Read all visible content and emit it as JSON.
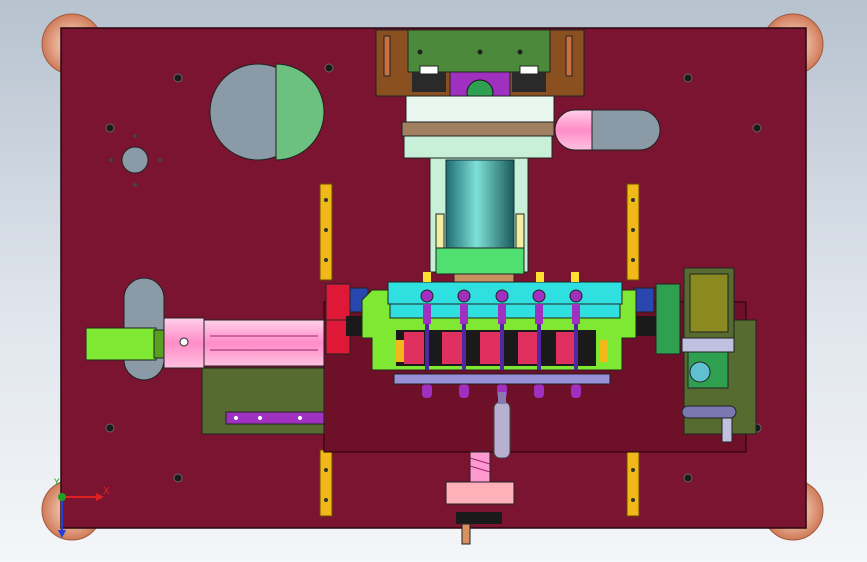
{
  "view": {
    "background": "#c8d0da",
    "plate_color": "#7a1430",
    "accent_colors": {
      "rail": "#f0b818",
      "slider": "#ff9ad0",
      "fixture": "#7fe832",
      "olive": "#556b2f",
      "cyan": "#30e0e0",
      "purple": "#a030c0",
      "pale_green": "#c8f0d8",
      "teal_roller": "#3aa8a0",
      "copper": "#d88868"
    }
  },
  "triad": {
    "x_label": "X",
    "y_label": "Y",
    "x_color": "#e02020",
    "y_color": "#20a020",
    "z_color": "#2040e0"
  },
  "components": {
    "base_plate": "cad-base-plate",
    "round_window": "cad-round-window",
    "top_bracket": "cad-top-bracket",
    "main_cylinder": "cad-main-cylinder",
    "side_cylinder": "cad-side-cylinder",
    "clamp_row_count": 5,
    "leadscrew": "cad-leadscrew",
    "motor": "cad-motor"
  }
}
